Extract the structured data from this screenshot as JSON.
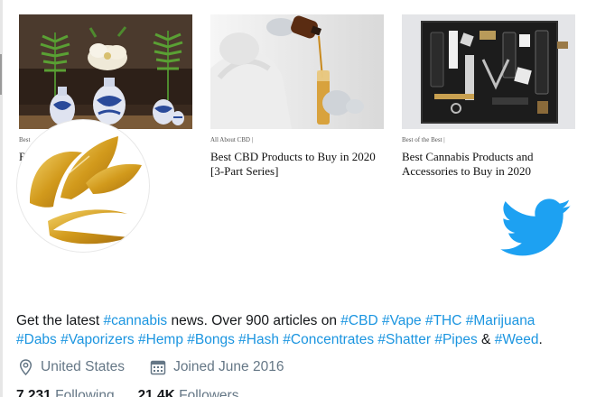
{
  "cards": [
    {
      "category": "Best",
      "headline": "Best Dry Herb Vaporizers"
    },
    {
      "category": "All About CBD |",
      "headline": "Best CBD Products to Buy in 2020 [3-Part Series]"
    },
    {
      "category": "Best of the Best |",
      "headline": "Best Cannabis Products and Accessories to Buy in 2020"
    }
  ],
  "bio": {
    "prefix": "Get the latest ",
    "tag_cannabis": "#cannabis",
    "middle": " news. Over 900 articles on ",
    "tags": [
      "#CBD",
      "#Vape",
      "#THC",
      "#Marijuana",
      "#Dabs",
      "#Vaporizers",
      "#Hemp",
      "#Bongs",
      "#Hash",
      "#Concentrates",
      "#Shatter",
      "#Pipes"
    ],
    "amp": " & ",
    "tag_last": "#Weed",
    "end": "."
  },
  "meta": {
    "location": "United States",
    "joined": "Joined June 2016"
  },
  "counts": {
    "following_num": "7,231",
    "following_label": "Following",
    "followers_num": "21.4K",
    "followers_label": "Followers"
  },
  "colors": {
    "link": "#1b95e0",
    "twitter_blue": "#1da1f2",
    "gold": "#d9a520",
    "muted": "#657786"
  },
  "icons": [
    "location-pin-icon",
    "calendar-icon",
    "twitter-bird-icon",
    "gold-leaf-logo-icon"
  ]
}
